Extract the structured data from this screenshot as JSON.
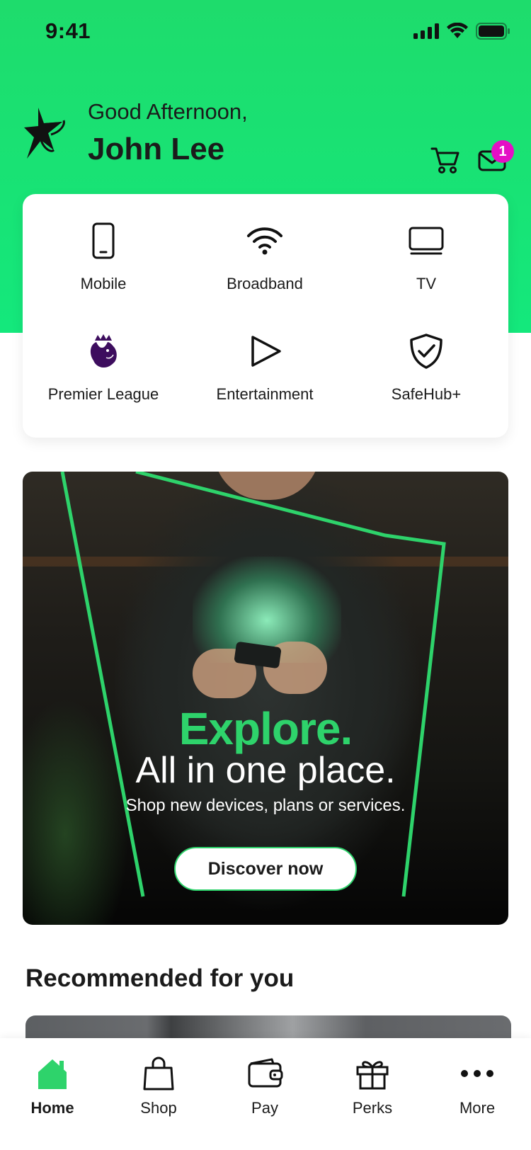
{
  "status_bar": {
    "time": "9:41"
  },
  "header": {
    "greeting": "Good Afternoon,",
    "user_name": "John Lee",
    "mail_badge_count": "1",
    "icons": [
      "logo-icon",
      "cart-icon",
      "mail-icon"
    ]
  },
  "services": [
    {
      "label": "Mobile",
      "icon": "mobile-phone-icon"
    },
    {
      "label": "Broadband",
      "icon": "wifi-icon"
    },
    {
      "label": "TV",
      "icon": "tv-icon"
    },
    {
      "label": "Premier League",
      "icon": "premier-league-icon"
    },
    {
      "label": "Entertainment",
      "icon": "play-icon"
    },
    {
      "label": "SafeHub+",
      "icon": "shield-check-icon"
    }
  ],
  "promo": {
    "title": "Explore.",
    "subtitle": "All in one place.",
    "description": "Shop new devices, plans or services.",
    "cta": "Discover now"
  },
  "recommended": {
    "title": "Recommended for you"
  },
  "tab_bar": {
    "tabs": [
      {
        "label": "Home",
        "icon": "home-icon",
        "active": true
      },
      {
        "label": "Shop",
        "icon": "shopping-bag-icon",
        "active": false
      },
      {
        "label": "Pay",
        "icon": "wallet-icon",
        "active": false
      },
      {
        "label": "Perks",
        "icon": "gift-icon",
        "active": false
      },
      {
        "label": "More",
        "icon": "more-dots-icon",
        "active": false
      }
    ]
  },
  "colors": {
    "brand_green": "#1edc6c",
    "accent_green": "#2ed36b",
    "badge_magenta": "#e40fc5",
    "premier_league_purple": "#3d0d5e"
  }
}
